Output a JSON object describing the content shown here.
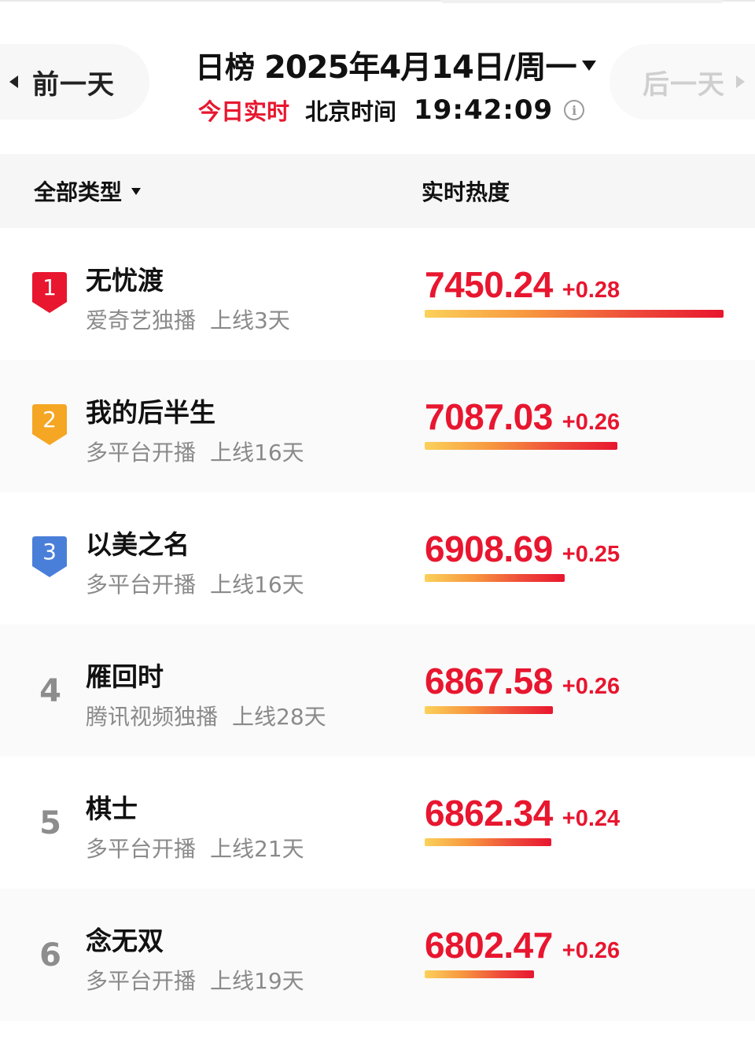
{
  "header": {
    "prev_label": "前一天",
    "next_label": "后一天",
    "title": "日榜",
    "date": "2025年4月14日/周一",
    "live_label": "今日实时",
    "timezone_label": "北京时间",
    "clock": "19:42:09"
  },
  "columns": {
    "filter_label": "全部类型",
    "heat_label": "实时热度"
  },
  "colors": {
    "accent": "#e8162f",
    "rank1": "#e8162f",
    "rank2": "#f5a623",
    "rank3": "#4a7fd9"
  },
  "items": [
    {
      "rank": "1",
      "name": "无忧渡",
      "platform": "爱奇艺独播",
      "online": "上线3天",
      "score": "7450.24",
      "delta": "+0.28",
      "heat": 7450.24
    },
    {
      "rank": "2",
      "name": "我的后半生",
      "platform": "多平台开播",
      "online": "上线16天",
      "score": "7087.03",
      "delta": "+0.26",
      "heat": 7087.03
    },
    {
      "rank": "3",
      "name": "以美之名",
      "platform": "多平台开播",
      "online": "上线16天",
      "score": "6908.69",
      "delta": "+0.25",
      "heat": 6908.69
    },
    {
      "rank": "4",
      "name": "雁回时",
      "platform": "腾讯视频独播",
      "online": "上线28天",
      "score": "6867.58",
      "delta": "+0.26",
      "heat": 6867.58
    },
    {
      "rank": "5",
      "name": "棋士",
      "platform": "多平台开播",
      "online": "上线21天",
      "score": "6862.34",
      "delta": "+0.24",
      "heat": 6862.34
    },
    {
      "rank": "6",
      "name": "念无双",
      "platform": "多平台开播",
      "online": "上线19天",
      "score": "6802.47",
      "delta": "+0.26",
      "heat": 6802.47
    }
  ]
}
